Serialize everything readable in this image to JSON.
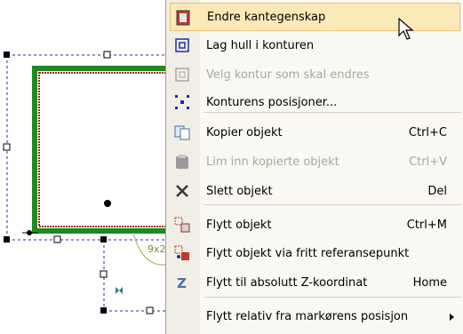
{
  "menu": {
    "items": [
      {
        "label": "Endre kantegenskap",
        "shortcut": "",
        "icon": "edge-properties-icon",
        "enabled": true,
        "highlighted": true
      },
      {
        "label": "Lag hull i konturen",
        "shortcut": "",
        "icon": "hole-icon",
        "enabled": true
      },
      {
        "label": "Velg kontur som skal endres",
        "shortcut": "",
        "icon": "select-contour-icon",
        "enabled": false
      },
      {
        "label": "Konturens posisjoner...",
        "shortcut": "",
        "icon": "positions-icon",
        "enabled": true
      },
      {
        "label": "Kopier objekt",
        "shortcut": "Ctrl+C",
        "icon": "copy-icon",
        "enabled": true
      },
      {
        "label": "Lim inn kopierte objekt",
        "shortcut": "Ctrl+V",
        "icon": "paste-icon",
        "enabled": false
      },
      {
        "label": "Slett objekt",
        "shortcut": "Del",
        "icon": "delete-icon",
        "enabled": true
      },
      {
        "label": "Flytt objekt",
        "shortcut": "Ctrl+M",
        "icon": "move-icon",
        "enabled": true
      },
      {
        "label": "Flytt objekt via fritt referansepunkt",
        "shortcut": "",
        "icon": "move-reference-icon",
        "enabled": true
      },
      {
        "label": "Flytt til absolutt Z-koordinat",
        "shortcut": "Home",
        "icon": "z-coordinate-icon",
        "enabled": true
      },
      {
        "label": "Flytt relativ fra markørens posisjon",
        "shortcut": "",
        "icon": "move-relative-icon",
        "enabled": true,
        "submenu": true
      }
    ]
  },
  "drawing": {
    "dimension_label": "9x2"
  },
  "colors": {
    "highlight_bg": "#fbe9b9",
    "highlight_border": "#e6c077",
    "contour_green": "#1f8a1f",
    "contour_red": "#a32020",
    "dimension_line": "#b8b06a",
    "selection_blue": "#1a2fa0"
  }
}
